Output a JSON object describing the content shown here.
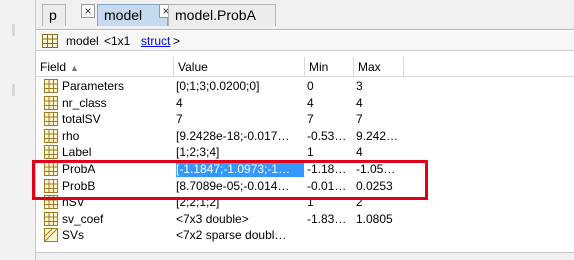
{
  "tabs": [
    {
      "label": "p",
      "active": false
    },
    {
      "label": "model",
      "active": true
    },
    {
      "label": "model.ProbA",
      "active": false
    }
  ],
  "tab_close_glyph": "×",
  "tab_add_glyph": "+",
  "info": {
    "name": "model",
    "size": "<1x1",
    "link": "struct",
    "close": ">"
  },
  "columns": [
    {
      "label": "Field",
      "sortable": true
    },
    {
      "label": "Value"
    },
    {
      "label": "Min"
    },
    {
      "label": "Max"
    }
  ],
  "rows": [
    {
      "field": "Parameters",
      "value": "[0;1;3;0.0200;0]",
      "min": "0",
      "max": "3",
      "icon": "grid-icon"
    },
    {
      "field": "nr_class",
      "value": "4",
      "min": "4",
      "max": "4",
      "icon": "grid-icon"
    },
    {
      "field": "totalSV",
      "value": "7",
      "min": "7",
      "max": "7",
      "icon": "grid-icon"
    },
    {
      "field": "rho",
      "value": "[9.2428e-18;-0.017…",
      "min": "-0.53…",
      "max": "9.242…",
      "icon": "grid-icon"
    },
    {
      "field": "Label",
      "value": "[1;2;3;4]",
      "min": "1",
      "max": "4",
      "icon": "grid-icon"
    },
    {
      "field": "ProbA",
      "value": "[-1.1847;-1.0973;-1…",
      "min": "-1.18…",
      "max": "-1.05…",
      "icon": "grid-icon",
      "selected": true
    },
    {
      "field": "ProbB",
      "value": "[8.7089e-05;-0.014…",
      "min": "-0.01…",
      "max": "0.0253",
      "icon": "grid-icon"
    },
    {
      "field": "nSV",
      "value": "[2;2;1;2]",
      "min": "1",
      "max": "2",
      "icon": "grid-icon"
    },
    {
      "field": "sv_coef",
      "value": "<7x3 double>",
      "min": "-1.83…",
      "max": "1.0805",
      "icon": "grid-icon"
    },
    {
      "field": "SVs",
      "value": "<7x2 sparse doubl…",
      "min": "",
      "max": "",
      "icon": "sparse-grid-icon"
    }
  ],
  "colors": {
    "selection": "#3399ff",
    "highlight_box": "#e0001a",
    "active_tab": "#c5d9ef",
    "link": "#0000ee"
  }
}
